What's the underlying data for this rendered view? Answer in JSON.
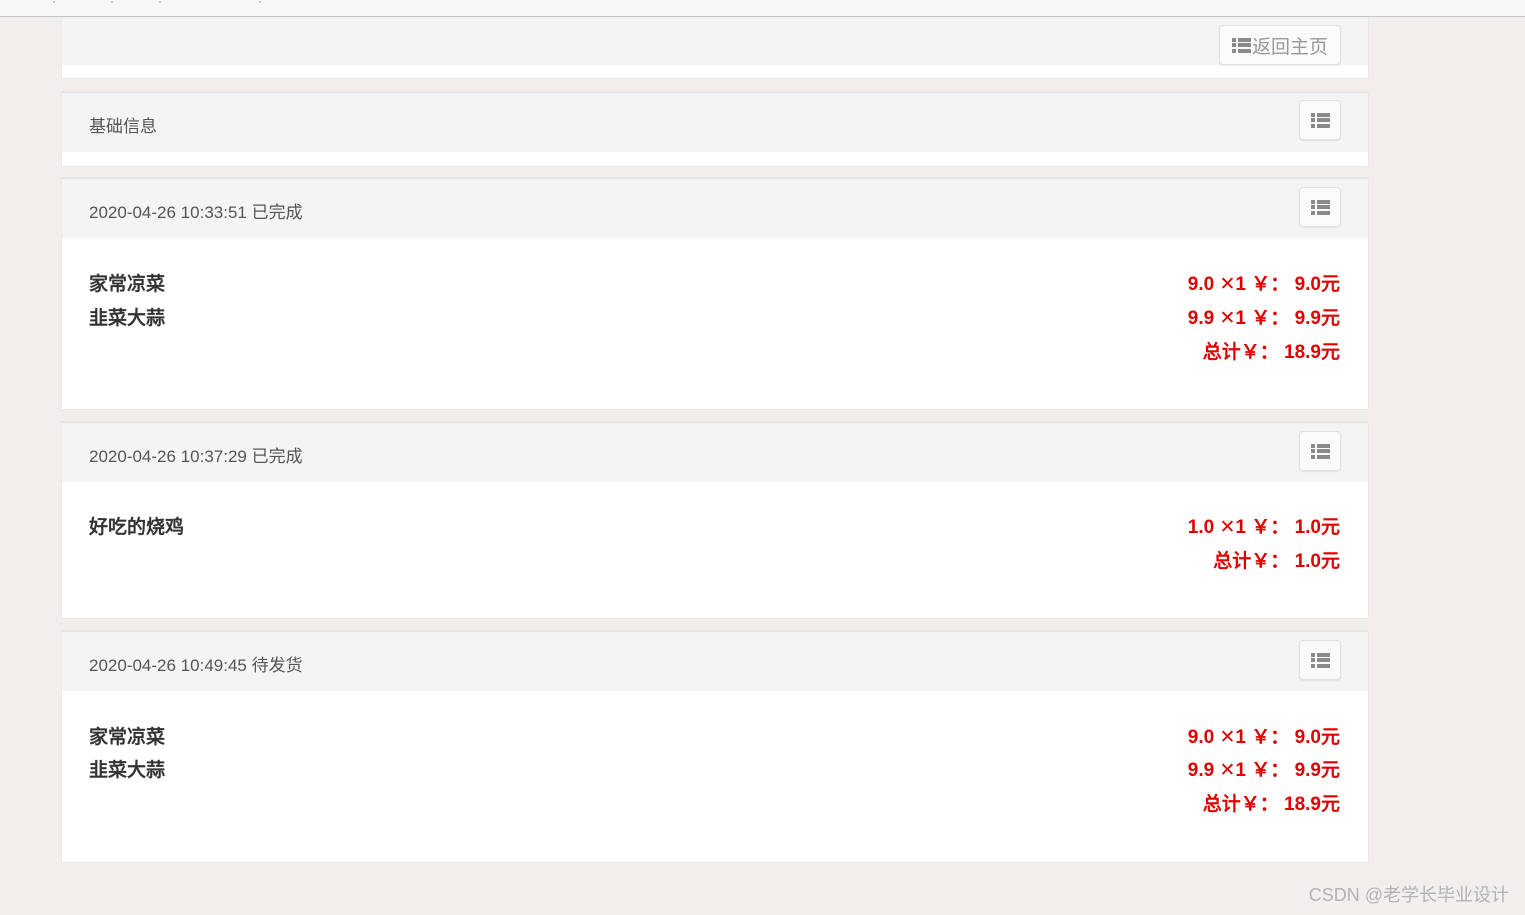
{
  "top_bar": {
    "fragments": [
      "·",
      "·",
      "·",
      "·"
    ]
  },
  "nav_panel": {
    "home_button_label": "返回主页",
    "home_button_icon": "list-icon"
  },
  "info_panel": {
    "title": "基础信息",
    "toggle_icon": "list-icon"
  },
  "orders": [
    {
      "time": "2020-04-26 10:33:51",
      "status": "已完成",
      "items": [
        {
          "name": "家常凉菜",
          "unit_price": "9.0",
          "qty_text": "✕1",
          "subtotal_label": "￥：",
          "subtotal": "9.0元"
        },
        {
          "name": "韭菜大蒜",
          "unit_price": "9.9",
          "qty_text": "✕1",
          "subtotal_label": "￥：",
          "subtotal": "9.9元"
        }
      ],
      "total_label": "总计￥：",
      "total": "18.9元"
    },
    {
      "time": "2020-04-26 10:37:29",
      "status": "已完成",
      "items": [
        {
          "name": "好吃的烧鸡",
          "unit_price": "1.0",
          "qty_text": "✕1",
          "subtotal_label": "￥：",
          "subtotal": "1.0元"
        }
      ],
      "total_label": "总计￥：",
      "total": "1.0元"
    },
    {
      "time": "2020-04-26 10:49:45",
      "status": "待发货",
      "items": [
        {
          "name": "家常凉菜",
          "unit_price": "9.0",
          "qty_text": "✕1",
          "subtotal_label": "￥：",
          "subtotal": "9.0元"
        },
        {
          "name": "韭菜大蒜",
          "unit_price": "9.9",
          "qty_text": "✕1",
          "subtotal_label": "￥：",
          "subtotal": "9.9元"
        }
      ],
      "total_label": "总计￥：",
      "total": "18.9元"
    }
  ],
  "watermark": "CSDN @老学长毕业设计",
  "colors": {
    "price_red": "#e00000",
    "page_bg": "#f1eeeb",
    "panel_heading_bg": "#f4f4f4"
  }
}
